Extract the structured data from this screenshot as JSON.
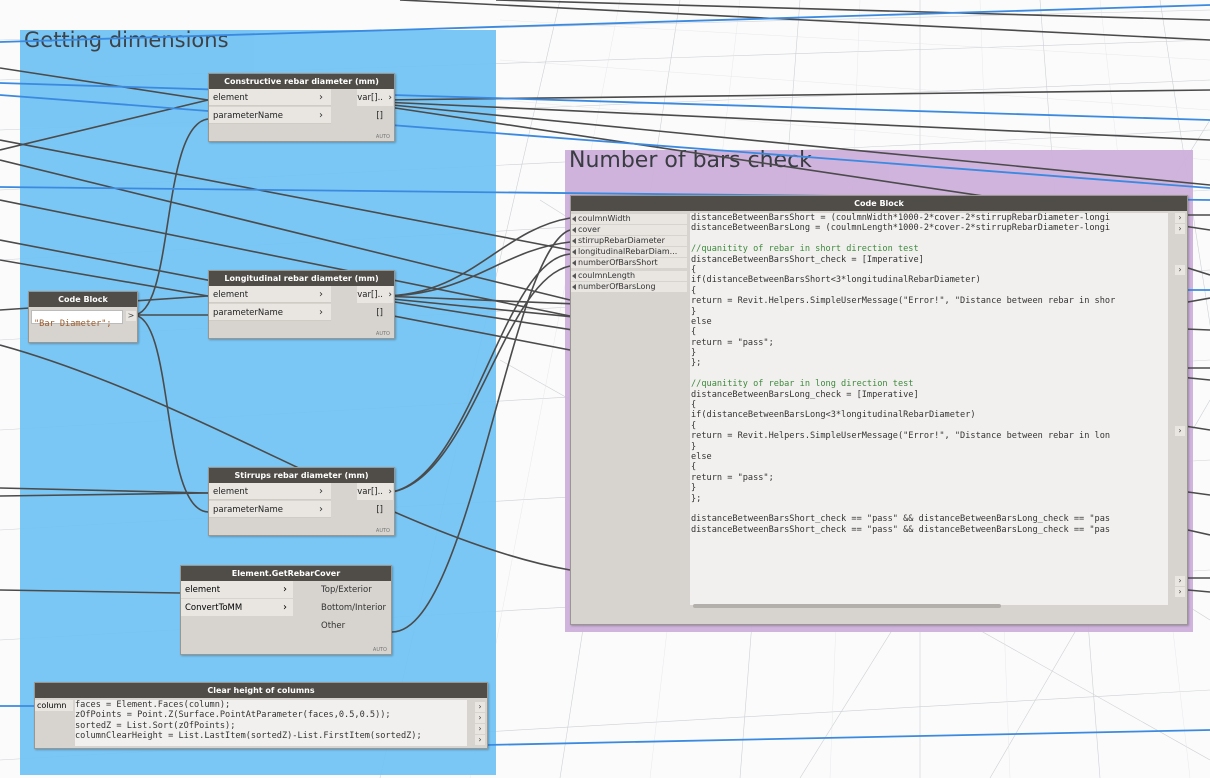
{
  "groups": {
    "getting_dimensions": "Getting dimensions",
    "number_of_bars": "Number of bars check"
  },
  "colors": {
    "group_blue": "#6fc2f4",
    "group_purple": "#cdb0dc",
    "node_title": "#504c47",
    "node_body": "#d7d4cf",
    "wire_dark": "#4b4b4b",
    "wire_blue": "#3b8ae0"
  },
  "nodes": {
    "constructive": {
      "title": "Constructive rebar diameter (mm)",
      "in1": "element",
      "in2": "parameterName",
      "out": "var[]..[]",
      "auto": "AUTO"
    },
    "longitudinal": {
      "title": "Longitudinal rebar diameter (mm)",
      "in1": "element",
      "in2": "parameterName",
      "out": "var[]..[]",
      "auto": "AUTO"
    },
    "stirrups": {
      "title": "Stirrups rebar diameter (mm)",
      "in1": "element",
      "in2": "parameterName",
      "out": "var[]..[]",
      "auto": "AUTO"
    },
    "code_small": {
      "title": "Code Block",
      "code": "\"Bar Diameter\";",
      "out": ">"
    },
    "rebar_cover": {
      "title": "Element.GetRebarCover",
      "in1": "element",
      "in2": "ConvertToMM",
      "out1": "Top/Exterior",
      "out2": "Bottom/Interior",
      "out3": "Other",
      "auto": "AUTO"
    },
    "clear_height": {
      "title": "Clear height of columns",
      "input": "column",
      "lines": [
        "faces = Element.Faces(column);",
        "zOfPoints = Point.Z(Surface.PointAtParameter(faces,0.5,0.5));",
        "sortedZ = List.Sort(zOfPoints);",
        "columnClearHeight = List.LastItem(sortedZ)-List.FirstItem(sortedZ);"
      ]
    },
    "code_big": {
      "title": "Code Block",
      "inputs": [
        "coulmnWidth",
        "cover",
        "stirrupRebarDiameter",
        "longitudinalRebarDiam...",
        "numberOfBarsShort",
        "coulmnLength",
        "numberOfBarsLong"
      ],
      "lines": [
        "distanceBetweenBarsShort = (coulmnWidth*1000-2*cover-2*stirrupRebarDiameter-longi",
        "distanceBetweenBarsLong = (coulmnLength*1000-2*cover-2*stirrupRebarDiameter-longi",
        "",
        "//quanitity of rebar in short direction test",
        "distanceBetweenBarsShort_check = [Imperative]",
        "{",
        "if(distanceBetweenBarsShort<3*longitudinalRebarDiameter)",
        "{",
        "return = Revit.Helpers.SimpleUserMessage(\"Error!\", \"Distance between rebar in shor",
        "}",
        "else",
        "{",
        "return = \"pass\";",
        "}",
        "};",
        "",
        "//quanitity of rebar in long direction test",
        "distanceBetweenBarsLong_check = [Imperative]",
        "{",
        "if(distanceBetweenBarsLong<3*longitudinalRebarDiameter)",
        "{",
        "return = Revit.Helpers.SimpleUserMessage(\"Error!\", \"Distance between rebar in lon",
        "}",
        "else",
        "{",
        "return = \"pass\";",
        "}",
        "};",
        "",
        "distanceBetweenBarsShort_check == \"pass\" && distanceBetweenBarsLong_check == \"pas",
        "distanceBetweenBarsShort_check == \"pass\" && distanceBetweenBarsLong_check == \"pas"
      ]
    }
  }
}
